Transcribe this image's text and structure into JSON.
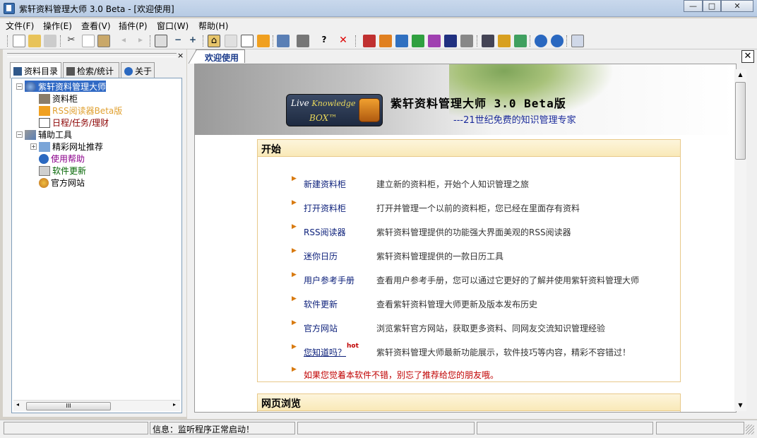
{
  "window": {
    "title": "紫轩资料管理大师 3.0 Beta - [欢迎使用]",
    "controls": {
      "minimize": "—",
      "maximize": "□",
      "close": "✕"
    }
  },
  "menu": [
    "文件(F)",
    "操作(E)",
    "查看(V)",
    "插件(P)",
    "窗口(W)",
    "帮助(H)"
  ],
  "toolbar": {
    "icons": [
      "new-icon",
      "open-folder-icon",
      "save-disabled-icon",
      "cut-icon",
      "copy-icon",
      "paste-icon",
      "undo-disabled-icon",
      "redo-disabled-icon",
      "panel-toggle-icon",
      "minus-icon",
      "plus-icon",
      "home-icon",
      "blank-doc-icon",
      "calendar-icon",
      "rss-icon",
      "export-icon",
      "print-icon",
      "help-icon",
      "delete-icon",
      "color-red-icon",
      "color-orange-icon",
      "color-blue-icon",
      "color-green-icon",
      "color-purple-icon",
      "color-navy-icon",
      "color-gray-icon",
      "binoculars-icon",
      "highlight-icon",
      "refresh-icon",
      "back-icon",
      "forward-icon",
      "note-icon"
    ]
  },
  "left_panel": {
    "close": "×",
    "tabs": [
      {
        "label": "资料目录",
        "icon": "catalog-icon"
      },
      {
        "label": "检索/统计",
        "icon": "binoculars-icon"
      },
      {
        "label": "关于",
        "icon": "info-icon"
      }
    ],
    "tree": [
      {
        "label": "紫轩资料管理大师",
        "icon": "globe-icon",
        "color": "#ffffff",
        "selected": true
      },
      {
        "label": "资料柜",
        "icon": "cabinet-icon",
        "color": "#000000"
      },
      {
        "label": "RSS阅读器Beta版",
        "icon": "rss-icon",
        "color": "#e0a030"
      },
      {
        "label": "日程/任务/理财",
        "icon": "calendar-icon",
        "color": "#8b0000"
      },
      {
        "label": "辅助工具",
        "icon": "wrench-icon",
        "color": "#000000"
      },
      {
        "label": "精彩网址推荐",
        "icon": "folder-link-icon",
        "color": "#000000"
      },
      {
        "label": "使用帮助",
        "icon": "help-icon",
        "color": "#8b008b"
      },
      {
        "label": "软件更新",
        "icon": "book-icon",
        "color": "#006400"
      },
      {
        "label": "官方网站",
        "icon": "web-icon",
        "color": "#000000"
      }
    ],
    "scroll_label": "III"
  },
  "document": {
    "tab_label": "欢迎使用",
    "close": "✕",
    "banner": {
      "logo_line1": "Live",
      "logo_line1b": "Knowledge",
      "logo_line2": "BOX™",
      "title": "紫轩资料管理大师 3.0 Beta版",
      "subtitle": "---21世纪免费的知识管理专家"
    },
    "section_start": {
      "heading": "开始",
      "items": [
        {
          "link": "新建资料柜",
          "desc": "建立新的资料柜，开始个人知识管理之旅"
        },
        {
          "link": "打开资料柜",
          "desc": "打开并管理一个以前的资料柜，您已经在里面存有资料"
        },
        {
          "link": "RSS阅读器",
          "desc": "紫轩资料管理提供的功能强大界面美观的RSS阅读器"
        },
        {
          "link": "迷你日历",
          "desc": "紫轩资料管理提供的一款日历工具"
        },
        {
          "link": "用户参考手册",
          "desc": "查看用户参考手册，您可以通过它更好的了解并使用紫轩资料管理大师"
        },
        {
          "link": "软件更新",
          "desc": "查看紫轩资料管理大师更新及版本发布历史"
        },
        {
          "link": "官方网站",
          "desc": "浏览紫轩官方网站，获取更多资料、同网友交流知识管理经验"
        },
        {
          "link": "您知道吗？",
          "desc": "紫轩资料管理大师最新功能展示，软件技巧等内容，精彩不容错过！",
          "badge": "hot"
        }
      ],
      "recommend": "如果您觉着本软件不错，别忘了推荐给您的朋友哦。"
    },
    "section_web": {
      "heading": "网页浏览"
    }
  },
  "status": {
    "message": "信息：监听程序正常启动！"
  }
}
